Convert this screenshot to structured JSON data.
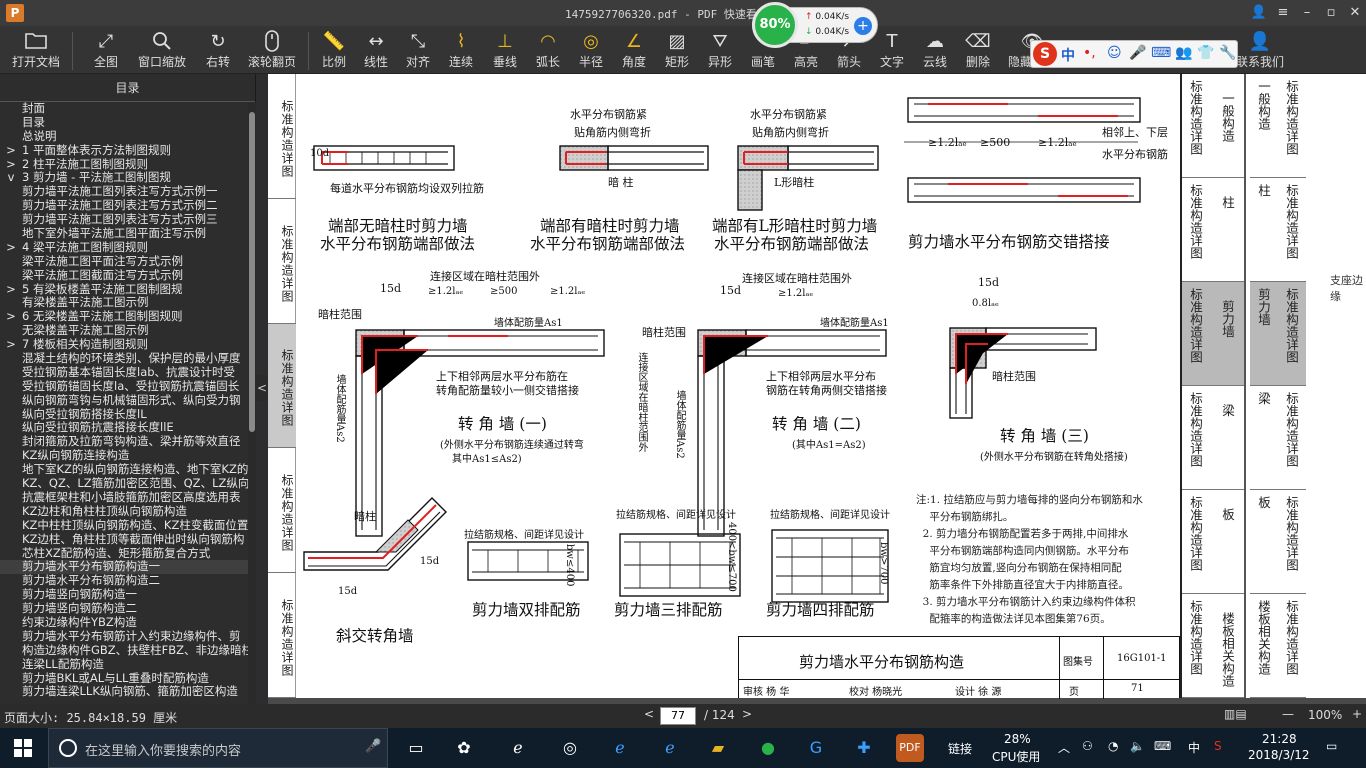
{
  "window": {
    "title": "1475927706320.pdf - PDF 快速看图 v1.9",
    "logo_letter": "P",
    "controls": {
      "user": "👤",
      "menu": "≡",
      "minimize": "–",
      "maximize": "▫",
      "close": "✕"
    }
  },
  "toolbar": {
    "open": "打开文档",
    "fullview": "全图",
    "window_zoom": "窗口缩放",
    "rotate_right": "右转",
    "scroll_page": "滚轮翻页",
    "scale": "比例",
    "linear": "线性",
    "aligned": "对齐",
    "continuous": "连续",
    "perpendicular": "垂线",
    "arc_length": "弧长",
    "radius": "半径",
    "angle": "角度",
    "rectangle": "矩形",
    "irregular": "异形",
    "pen": "画笔",
    "highlight": "高亮",
    "arrow": "箭头",
    "text": "文字",
    "cloud": "云线",
    "delete": "删除",
    "hide": "隐藏标注",
    "links": "联系我们",
    "text_icon": "T"
  },
  "speed_widget": {
    "percent": "80%",
    "upload": "0.04K/s",
    "download": "0.04K/s",
    "plus": "+"
  },
  "ime": {
    "logo": "S",
    "lang": "中",
    "punct": "•,",
    "icons": [
      "☺",
      "🎤",
      "⌨",
      "👥",
      "👕",
      "🔧"
    ]
  },
  "sidebar": {
    "header": "目录",
    "collapse": "<",
    "items": [
      {
        "text": "封面",
        "arrow": ""
      },
      {
        "text": "目录",
        "arrow": ""
      },
      {
        "text": "总说明",
        "arrow": ""
      },
      {
        "text": "1 平面整体表示方法制图规则",
        "arrow": ">"
      },
      {
        "text": "2 柱平法施工图制图规则",
        "arrow": ">"
      },
      {
        "text": "3 剪力墙 - 平法施工图制图规",
        "arrow": "v"
      },
      {
        "text": "剪力墙平法施工图列表注写方式示例一",
        "arrow": ""
      },
      {
        "text": "剪力墙平法施工图列表注写方式示例二",
        "arrow": ""
      },
      {
        "text": "剪力墙平法施工图列表注写方式示例三",
        "arrow": ""
      },
      {
        "text": "地下室外墙平法施工图平面注写示例",
        "arrow": ""
      },
      {
        "text": "4 梁平法施工图制图规则",
        "arrow": ">"
      },
      {
        "text": "梁平法施工图平面注写方式示例",
        "arrow": ""
      },
      {
        "text": "梁平法施工图截面注写方式示例",
        "arrow": ""
      },
      {
        "text": "5 有梁板楼盖平法施工图制图规",
        "arrow": ">"
      },
      {
        "text": "有梁楼盖平法施工图示例",
        "arrow": ""
      },
      {
        "text": "6 无梁楼盖平法施工图制图规则",
        "arrow": ">"
      },
      {
        "text": "无梁楼盖平法施工图示例",
        "arrow": ""
      },
      {
        "text": "7 楼板相关构造制图规则",
        "arrow": ">"
      },
      {
        "text": "混凝土结构的环境类别、保护层的最小厚度",
        "arrow": ""
      },
      {
        "text": "受拉钢筋基本锚固长度lab、抗震设计时受",
        "arrow": ""
      },
      {
        "text": "受拉钢筋锚固长度la、受拉钢筋抗震锚固长",
        "arrow": ""
      },
      {
        "text": "纵向钢筋弯钩与机械锚固形式、纵向受力钢",
        "arrow": ""
      },
      {
        "text": "纵向受拉钢筋搭接长度lL",
        "arrow": ""
      },
      {
        "text": "纵向受拉钢筋抗震搭接长度llE",
        "arrow": ""
      },
      {
        "text": "封闭箍筋及拉筋弯钩构造、梁并筋等效直径",
        "arrow": ""
      },
      {
        "text": "KZ纵向钢筋连接构造",
        "arrow": ""
      },
      {
        "text": "地下室KZ的纵向钢筋连接构造、地下室KZ的",
        "arrow": ""
      },
      {
        "text": "KZ、QZ、LZ箍筋加密区范围、QZ、LZ纵向钢",
        "arrow": ""
      },
      {
        "text": "抗震框架柱和小墙肢箍筋加密区高度选用表",
        "arrow": ""
      },
      {
        "text": "KZ边柱和角柱柱顶纵向钢筋构造",
        "arrow": ""
      },
      {
        "text": "KZ中柱柱顶纵向钢筋构造、KZ柱变截面位置",
        "arrow": ""
      },
      {
        "text": "KZ边柱、角柱柱顶等截面伸出时纵向钢筋构",
        "arrow": ""
      },
      {
        "text": "芯柱XZ配筋构造、矩形箍筋复合方式",
        "arrow": ""
      },
      {
        "text": "剪力墙水平分布钢筋构造一",
        "arrow": ""
      },
      {
        "text": "剪力墙水平分布钢筋构造二",
        "arrow": ""
      },
      {
        "text": "剪力墙竖向钢筋构造一",
        "arrow": ""
      },
      {
        "text": "剪力墙竖向钢筋构造二",
        "arrow": ""
      },
      {
        "text": "约束边缘构件YBZ构造",
        "arrow": ""
      },
      {
        "text": "剪力墙水平分布钢筋计入约束边缘构件、剪",
        "arrow": ""
      },
      {
        "text": "构造边缘构件GBZ、扶壁柱FBZ、非边缘暗柱",
        "arrow": ""
      },
      {
        "text": "连梁LL配筋构造",
        "arrow": ""
      },
      {
        "text": "剪力墙BKL或AL与LL重叠时配筋构造",
        "arrow": ""
      },
      {
        "text": "剪力墙连梁LLK纵向钢筋、箍筋加密区构造",
        "arrow": ""
      }
    ],
    "selected_index": 33
  },
  "document": {
    "left_tabs": [
      {
        "text": "标准构造详图",
        "gray": false
      },
      {
        "text": "标准构造详图",
        "gray": false
      },
      {
        "text": "标准构造详图",
        "gray": true
      },
      {
        "text": "标准构造详图",
        "gray": false
      },
      {
        "text": "标准构造详图",
        "gray": false
      }
    ],
    "right_tabs": [
      {
        "a": "标准构造详图",
        "b": "一般构造",
        "gray": false
      },
      {
        "a": "标准构造详图",
        "b": "柱",
        "gray": false
      },
      {
        "a": "标准构造详图",
        "b": "剪力墙",
        "gray": true
      },
      {
        "a": "标准构造详图",
        "b": "梁",
        "gray": false
      },
      {
        "a": "标准构造详图",
        "b": "板",
        "gray": false
      },
      {
        "a": "标准构造详图",
        "b": "楼板相关构造",
        "gray": false
      }
    ],
    "next_tabs": [
      {
        "a": "一般构造",
        "b": "标准构造详图",
        "gray": false
      },
      {
        "a": "柱",
        "b": "标准构造详图",
        "gray": false
      },
      {
        "a": "剪力墙",
        "b": "标准构造详图",
        "gray": true
      },
      {
        "a": "梁",
        "b": "标准构造详图",
        "gray": false
      },
      {
        "a": "板",
        "b": "标准构造详图",
        "gray": false
      },
      {
        "a": "楼板相关构造",
        "b": "标准构造详图",
        "gray": false
      }
    ],
    "next_note": "支座边缘",
    "captions": {
      "d1_note": "每道水平分布钢筋均设双列拉筋",
      "d1_t1": "端部无暗柱时剪力墙",
      "d1_t2": "水平分布钢筋端部做法",
      "d2_a": "水平分布钢筋紧",
      "d2_b": "贴角筋内侧弯折",
      "d2_c": "暗 柱",
      "d2_t1": "端部有暗柱时剪力墙",
      "d2_t2": "水平分布钢筋端部做法",
      "d3_a": "水平分布钢筋紧",
      "d3_b": "贴角筋内侧弯折",
      "d3_c": "L形暗柱",
      "d3_t1": "端部有L形暗柱时剪力墙",
      "d3_t2": "水平分布钢筋端部做法",
      "d4_dim1": "≥1.2lₐₑ",
      "d4_dim2": "≥500",
      "d4_dim3": "≥1.2lₐₑ",
      "d4_a": "相邻上、下层",
      "d4_b": "水平分布钢筋",
      "d4_t": "剪力墙水平分布钢筋交错搭接",
      "d1_dim": "10d",
      "d5_conn": "连接区域在暗柱范围外",
      "d5_15d": "15d",
      "d5_dim1": "≥1.2lₐₑ",
      "d5_dim2": "≥500",
      "d5_dim3": "≥1.2lₐₑ",
      "d5_range": "暗柱范围",
      "d5_as1": "墙体配筋量As1",
      "d5_as2": "墙体配筋量As2",
      "d5_note1": "上下相邻两层水平分布筋在",
      "d5_note2": "转角配筋量较小一侧交错搭接",
      "d5_t": "转 角 墙 (一)",
      "d5_s1": "(外侧水平分布钢筋连续通过转弯",
      "d5_s2": "其中As1≤As2)",
      "d6_conn": "连接区域在暗柱范围外",
      "d6_15d": "15d",
      "d6_dim1": "≥1.2lₐₑ",
      "d6_range": "暗柱范围",
      "d6_as1": "墙体配筋量As1",
      "d6_vconn": "连接区域在暗柱范围外",
      "d6_as2": "墙体配筋量As2",
      "d6_note1": "上下相邻两层水平分布",
      "d6_note2": "钢筋在转角两侧交错搭接",
      "d6_t": "转 角 墙 (二)",
      "d6_s": "(其中As1=As2)",
      "d7_15d": "15d",
      "d7_08": "0.8lₐₑ",
      "d7_range": "暗柱范围",
      "d7_t": "转 角 墙 (三)",
      "d7_s": "(外侧水平分布钢筋在转角处搭接)",
      "d8_label": "暗柱",
      "d8_15d_a": "15d",
      "d8_15d_b": "15d",
      "d8_t": "斜交转角墙",
      "d9_top": "拉结筋规格、间距详见设计",
      "d9_t": "剪力墙双排配筋",
      "d10_top": "拉结筋规格、间距详见设计",
      "d10_t": "剪力墙三排配筋",
      "d11_top": "拉结筋规格、间距详见设计",
      "d11_t": "剪力墙四排配筋",
      "d9_bw": "bw≤400",
      "d10_bw": "400<bw≤700",
      "d11_bw": "bw>700"
    },
    "notes": [
      "注:1. 拉结筋应与剪力墙每排的竖向分布钢筋和水",
      "    平分布钢筋绑扎。",
      "  2. 剪力墙分布钢筋配置若多于两排,中间排水",
      "    平分布钢筋端部构造同内侧钢筋。水平分布",
      "    筋宜均匀放置,竖向分布钢筋在保持相同配",
      "    筋率条件下外排筋直径宜大于内排筋直径。",
      "  3. 剪力墙水平分布钢筋计入约束边缘构件体积",
      "    配箍率的构造做法详见本图集第76页。"
    ],
    "title_block": {
      "title": "剪力墙水平分布钢筋构造",
      "atlas_label": "图集号",
      "atlas_no": "16G101-1",
      "page_label": "页",
      "page_no": "71",
      "review": "审核 杨 华",
      "check": "校对 杨晓光",
      "design": "设计 徐 源"
    }
  },
  "statusbar": {
    "page_size": "页面大小: 25.84×18.59 厘米",
    "prev": "<",
    "current_page": "77",
    "total": "/ 124",
    "next": ">",
    "zoom_minus": "—",
    "zoom_value": "100%",
    "zoom_plus": "+"
  },
  "taskbar": {
    "search_placeholder": "在这里输入你要搜索的内容",
    "links_label": "链接",
    "cpu_percent": "28%",
    "cpu_label": "CPU使用",
    "lang": "中",
    "time": "21:28",
    "date": "2018/3/12"
  },
  "colors": {
    "accent_green": "#2ab24a",
    "rebar_red": "#e02020",
    "sidebar_bg": "#2d2d2d"
  }
}
